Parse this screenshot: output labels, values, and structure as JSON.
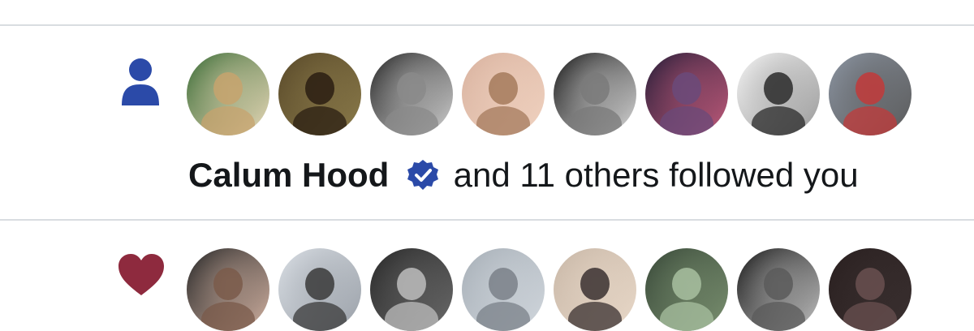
{
  "notifications": [
    {
      "type": "follow",
      "icon": "person-icon",
      "user_name": "Calum Hood",
      "verified": true,
      "action_text": "and 11 others followed you",
      "avatar_colors": [
        [
          "#3f6f3a",
          "#c7a36d",
          "#e8d8b8"
        ],
        [
          "#5a4a2a",
          "#2a1d12",
          "#8a7a4a"
        ],
        [
          "#2b2b2b",
          "#8a8a8a",
          "#cfcfcf"
        ],
        [
          "#d9b3a0",
          "#a47a5c",
          "#f0d2c0"
        ],
        [
          "#1e1e1e",
          "#7a7a7a",
          "#d8d8d8"
        ],
        [
          "#2a1f3a",
          "#6a4a7a",
          "#c05a7a"
        ],
        [
          "#f2f2f2",
          "#2a2a2a",
          "#9a9a9a"
        ],
        [
          "#8a93a0",
          "#c23a3a",
          "#5a5a5a"
        ]
      ]
    },
    {
      "type": "like",
      "icon": "heart-icon",
      "avatar_colors": [
        [
          "#2a2a2a",
          "#7a5a4a",
          "#d0b0a0"
        ],
        [
          "#d8dde3",
          "#3a3a3a",
          "#9aa0a8"
        ],
        [
          "#2a2a2a",
          "#bdbdbd",
          "#6a6a6a"
        ],
        [
          "#a8b0b8",
          "#7a8088",
          "#d0d6dc"
        ],
        [
          "#c9b8a8",
          "#3a3030",
          "#e8d8c8"
        ],
        [
          "#3a4a3a",
          "#a8c0a0",
          "#7a9070"
        ],
        [
          "#1e1e1e",
          "#5a5a5a",
          "#bfbfbf"
        ],
        [
          "#2a2020",
          "#6a5050",
          "#3a3030"
        ]
      ]
    }
  ],
  "colors": {
    "accent": "#2b4aa8",
    "heart": "#8e2a3e",
    "text": "#14171a",
    "divider": "#d9dde1"
  }
}
